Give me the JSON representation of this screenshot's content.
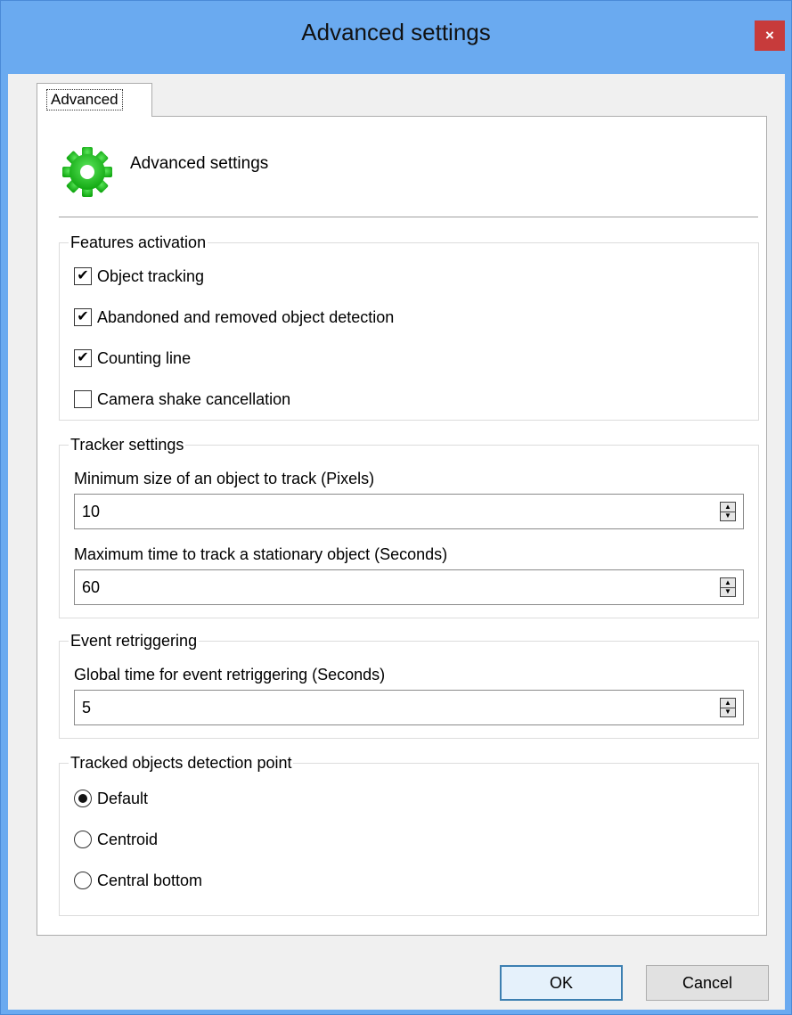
{
  "window": {
    "title": "Advanced settings",
    "close_glyph": "×"
  },
  "tabs": [
    {
      "label": "Advanced",
      "selected": true
    }
  ],
  "header": {
    "icon": "gear-icon",
    "icon_color": "#1fc41f",
    "text": "Advanced settings"
  },
  "features": {
    "title": "Features activation",
    "items": [
      {
        "label": "Object tracking",
        "checked": true
      },
      {
        "label": "Abandoned and removed object detection",
        "checked": true
      },
      {
        "label": "Counting line",
        "checked": true
      },
      {
        "label": "Camera shake cancellation",
        "checked": false
      }
    ]
  },
  "tracker": {
    "title": "Tracker settings",
    "min_size_label": "Minimum size of an object to track (Pixels)",
    "min_size_value": "10",
    "max_time_label": "Maximum time to track a stationary object (Seconds)",
    "max_time_value": "60"
  },
  "retrigger": {
    "title": "Event retriggering",
    "global_time_label": "Global time for event retriggering (Seconds)",
    "global_time_value": "5"
  },
  "detection_point": {
    "title": "Tracked objects detection point",
    "options": [
      {
        "label": "Default",
        "selected": true
      },
      {
        "label": "Centroid",
        "selected": false
      },
      {
        "label": "Central bottom",
        "selected": false
      }
    ]
  },
  "buttons": {
    "ok_label": "OK",
    "cancel_label": "Cancel"
  },
  "glyphs": {
    "check": "✔",
    "spin_up": "▲",
    "spin_down": "▼"
  }
}
